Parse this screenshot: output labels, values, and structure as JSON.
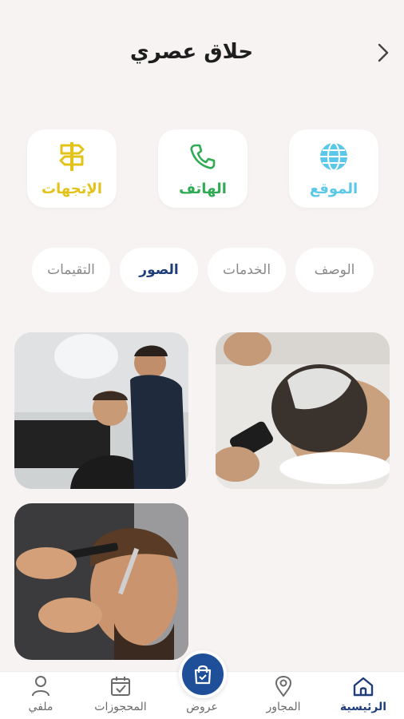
{
  "header": {
    "title": "حلاق عصري"
  },
  "actions": {
    "location": {
      "label": "الموقع",
      "icon": "globe-icon",
      "color": "#5bc8e8"
    },
    "phone": {
      "label": "الهاتف",
      "icon": "phone-icon",
      "color": "#2faa55"
    },
    "directions": {
      "label": "الإتجهات",
      "icon": "signpost-icon",
      "color": "#e3c21a"
    }
  },
  "tabs": [
    {
      "label": "الوصف",
      "active": false
    },
    {
      "label": "الخدمات",
      "active": false
    },
    {
      "label": "الصور",
      "active": true
    },
    {
      "label": "التقيمات",
      "active": false
    }
  ],
  "gallery": {
    "photos": [
      {
        "description": "hair-wash"
      },
      {
        "description": "haircut-salon"
      },
      {
        "description": "comb-and-scissors"
      }
    ]
  },
  "bottom_nav": {
    "items": [
      {
        "label": "الرئيسية",
        "icon": "home-icon",
        "active": true
      },
      {
        "label": "المجاور",
        "icon": "location-pin-icon",
        "active": false
      },
      {
        "label": "عروض",
        "icon": "shopping-bag-icon",
        "active": false
      },
      {
        "label": "المحجوزات",
        "icon": "calendar-icon",
        "active": false
      },
      {
        "label": "ملفي",
        "icon": "user-icon",
        "active": false
      }
    ]
  },
  "colors": {
    "accent": "#1f4f98",
    "active_tab": "#1f3d7a",
    "background": "#f6f3f2"
  }
}
